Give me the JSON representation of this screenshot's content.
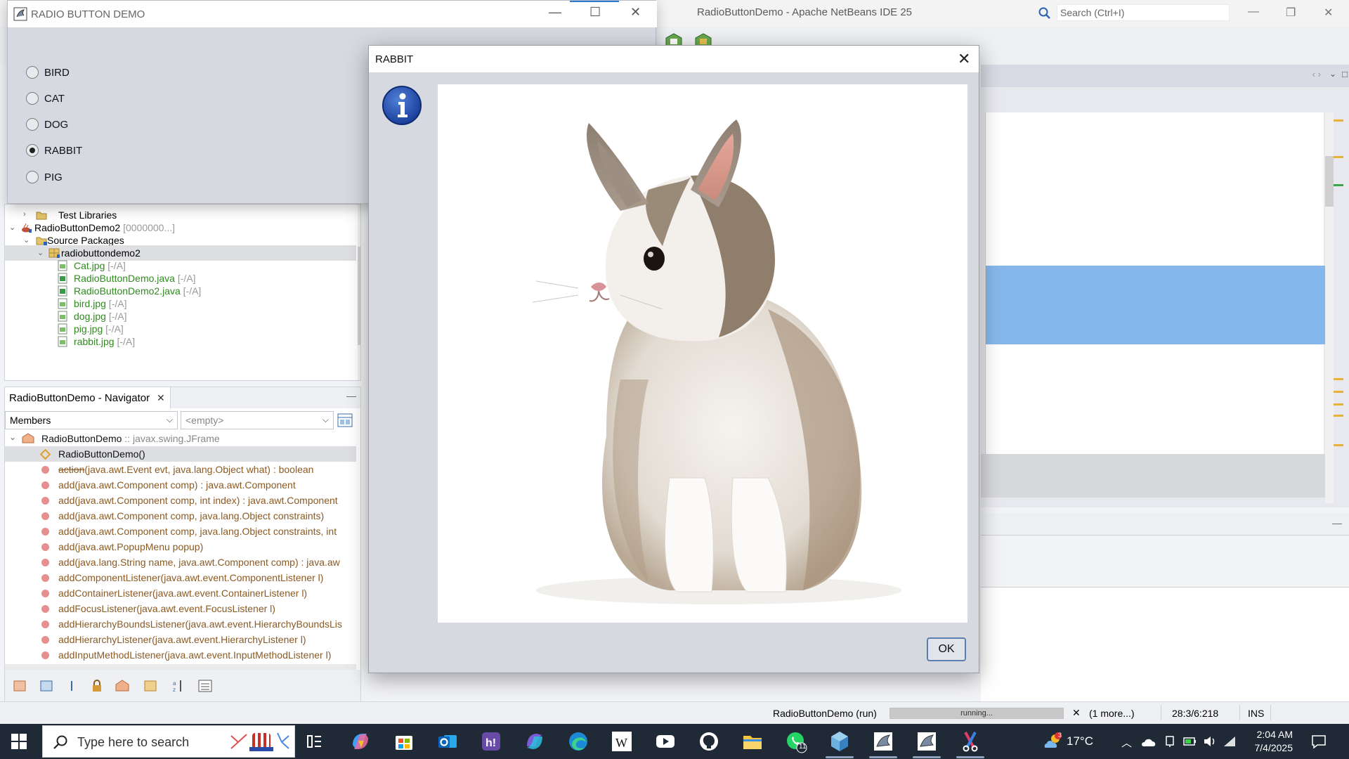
{
  "ide": {
    "title": "RadioButtonDemo - Apache NetBeans IDE 25",
    "search_placeholder": "Search (Ctrl+I)",
    "projects": [
      {
        "label": "Test Libraries",
        "suffix": "",
        "kind": "folder"
      },
      {
        "label": "RadioButtonDemo2",
        "suffix": " [0000000...]",
        "kind": "project"
      },
      {
        "label": "Source Packages",
        "suffix": "",
        "kind": "folder"
      },
      {
        "label": "radiobuttondemo2",
        "suffix": "",
        "kind": "package"
      },
      {
        "label": "Cat.jpg",
        "suffix": " [-/A]",
        "kind": "file"
      },
      {
        "label": "RadioButtonDemo.java",
        "suffix": " [-/A]",
        "kind": "file"
      },
      {
        "label": "RadioButtonDemo2.java",
        "suffix": " [-/A]",
        "kind": "file"
      },
      {
        "label": "bird.jpg",
        "suffix": " [-/A]",
        "kind": "file"
      },
      {
        "label": "dog.jpg",
        "suffix": " [-/A]",
        "kind": "file"
      },
      {
        "label": "pig.jpg",
        "suffix": " [-/A]",
        "kind": "file"
      },
      {
        "label": "rabbit.jpg",
        "suffix": " [-/A]",
        "kind": "file"
      }
    ],
    "navigator": {
      "tab": "RadioButtonDemo - Navigator",
      "filter": "Members",
      "filter2": "<empty>",
      "root": "RadioButtonDemo",
      "root_type": " :: javax.swing.JFrame",
      "members": [
        "RadioButtonDemo()",
        "action",
        "add(java.awt.Component comp) : java.awt.Component",
        "add(java.awt.Component comp, int index) : java.awt.Component",
        "add(java.awt.Component comp, java.lang.Object constraints)",
        "add(java.awt.Component comp, java.lang.Object constraints, int",
        "add(java.awt.PopupMenu popup)",
        "add(java.lang.String name, java.awt.Component comp) : java.aw",
        "addComponentListener(java.awt.event.ComponentListener l)",
        "addContainerListener(java.awt.event.ContainerListener l)",
        "addFocusListener(java.awt.event.FocusListener l)",
        "addHierarchyBoundsListener(java.awt.event.HierarchyBoundsLis",
        "addHierarchyListener(java.awt.event.HierarchyListener l)",
        "addInputMethodListener(java.awt.event.InputMethodListener l)"
      ],
      "action_sig": "(java.awt.Event evt, java.lang.Object what) : boolean"
    },
    "status": {
      "process": "RadioButtonDemo (run)",
      "progress_text": "running...",
      "more": "(1 more...)",
      "position": "28:3/6:218",
      "mode": "INS"
    }
  },
  "radio_window": {
    "title": "RADIO BUTTON DEMO",
    "options": [
      {
        "label": "BIRD",
        "selected": false
      },
      {
        "label": "CAT",
        "selected": false
      },
      {
        "label": "DOG",
        "selected": false
      },
      {
        "label": "RABBIT",
        "selected": true
      },
      {
        "label": "PIG",
        "selected": false
      }
    ]
  },
  "dialog": {
    "title": "RABBIT",
    "ok_label": "OK"
  },
  "taskbar": {
    "search_placeholder": "Type here to search",
    "temperature": "17°C",
    "weather_badge": "3",
    "whatsapp_badge": "11",
    "time": "2:04 AM",
    "date": "7/4/2025"
  }
}
